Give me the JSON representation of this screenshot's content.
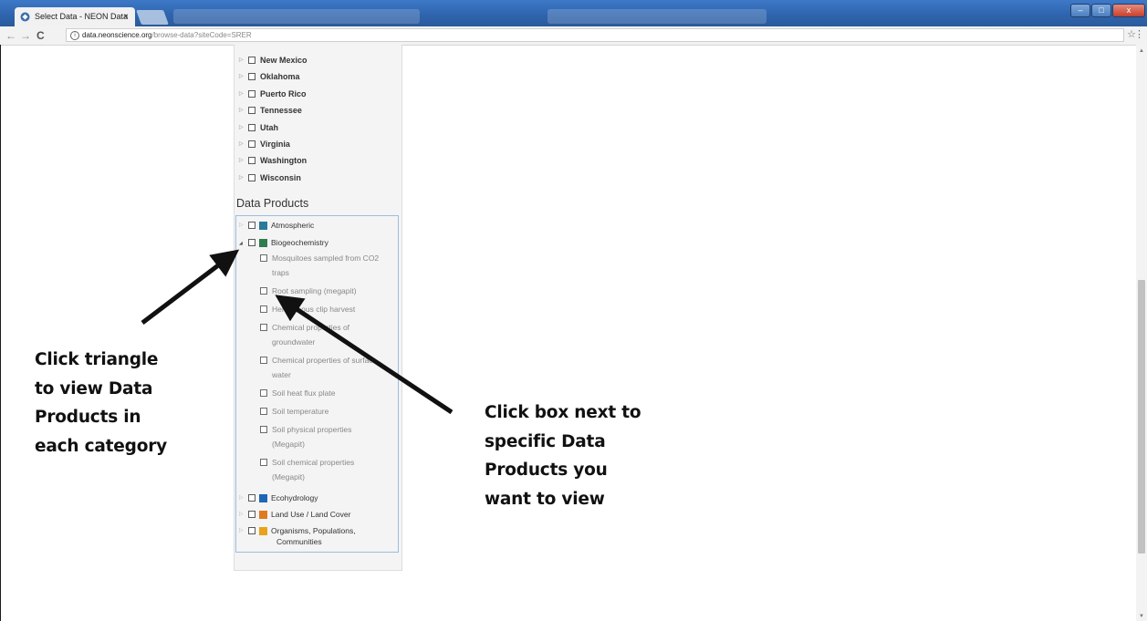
{
  "browser": {
    "tab_title": "Select Data - NEON Data",
    "tab_close": "×",
    "url_host": "data.neonscience.org",
    "url_path": "/browse-data?siteCode=SRER",
    "back": "←",
    "forward": "→",
    "reload": "C",
    "info": "i",
    "star": "☆",
    "menu": "⋮",
    "min": "–",
    "max": "□",
    "close": "x"
  },
  "sidebar": {
    "states": [
      "New Mexico",
      "Oklahoma",
      "Puerto Rico",
      "Tennessee",
      "Utah",
      "Virginia",
      "Washington",
      "Wisconsin"
    ],
    "data_products_title": "Data Products",
    "categories_top": [
      {
        "label": "Atmospheric",
        "icon": "atmospheric-icon",
        "color": "#2a7a9a",
        "expanded": false
      },
      {
        "label": "Biogeochemistry",
        "icon": "biogeochemistry-icon",
        "color": "#2f7d4c",
        "expanded": true
      }
    ],
    "biogeochemistry_products": [
      [
        "Mosquitoes sampled from CO2",
        "traps"
      ],
      [
        "Root sampling (megapit)"
      ],
      [
        "Herbaceous clip harvest"
      ],
      [
        "Chemical properties of",
        "groundwater"
      ],
      [
        "Chemical properties of surface",
        "water"
      ],
      [
        "Soil heat flux plate"
      ],
      [
        "Soil temperature"
      ],
      [
        "Soil physical properties",
        "(Megapit)"
      ],
      [
        "Soil chemical properties",
        "(Megapit)"
      ]
    ],
    "categories_bottom": [
      {
        "label": "Ecohydrology",
        "icon": "ecohydrology-icon",
        "color": "#1f66b5"
      },
      {
        "label": "Land Use / Land Cover",
        "icon": "land-use-icon",
        "color": "#e07a1f"
      },
      {
        "label": [
          "Organisms, Populations,",
          "Communities"
        ],
        "icon": "organisms-icon",
        "color": "#e8a21c"
      }
    ]
  },
  "annotations": {
    "left": [
      "Click triangle",
      "to view Data",
      "Products in",
      "each category"
    ],
    "right": [
      "Click box next to",
      "specific Data",
      "Products you",
      "want to view"
    ]
  }
}
